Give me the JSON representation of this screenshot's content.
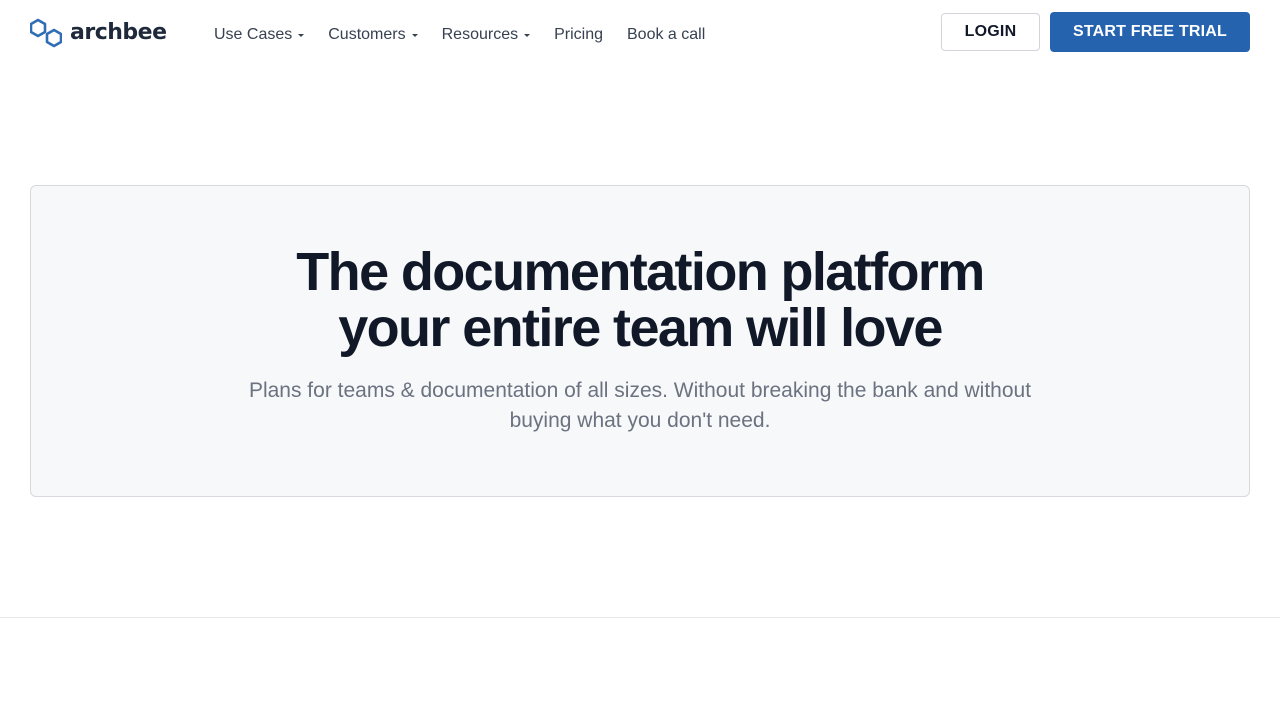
{
  "brand": {
    "name": "archbee",
    "logo_color": "#2f6db5"
  },
  "nav": {
    "items": [
      {
        "label": "Use Cases",
        "has_dropdown": true
      },
      {
        "label": "Customers",
        "has_dropdown": true
      },
      {
        "label": "Resources",
        "has_dropdown": true
      },
      {
        "label": "Pricing",
        "has_dropdown": false
      },
      {
        "label": "Book a call",
        "has_dropdown": false
      }
    ]
  },
  "header_actions": {
    "login_label": "LOGIN",
    "trial_label": "START FREE TRIAL",
    "trial_color": "#2563ae"
  },
  "hero": {
    "title_line1": "The documentation platform",
    "title_line2": "your entire team will love",
    "subtitle": "Plans for teams & documentation of all sizes. Without breaking the bank and without buying what you don't need."
  },
  "icons": {
    "logo": "hexagon-logo-icon",
    "dropdown": "caret-down-icon"
  }
}
